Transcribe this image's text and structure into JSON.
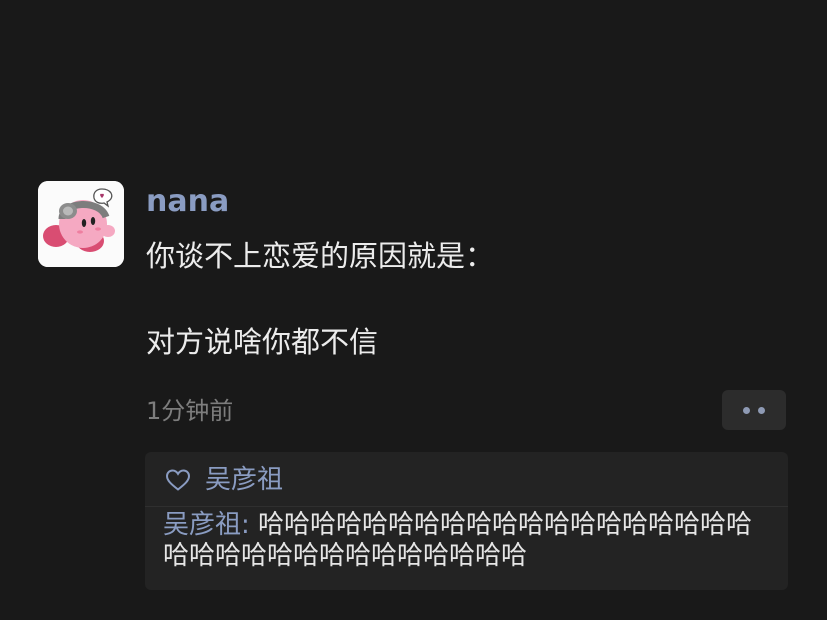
{
  "post": {
    "username": "nana",
    "content_lines": [
      "你谈不上恋爱的原因就是：",
      "对方说啥你都不信"
    ],
    "timestamp": "1分钟前"
  },
  "likes": {
    "icon": "heart-outline-icon",
    "names": "吴彦祖"
  },
  "comment": {
    "author": "吴彦祖",
    "separator": ": ",
    "text": "哈哈哈哈哈哈哈哈哈哈哈哈哈哈哈哈哈哈哈哈哈哈哈哈哈哈哈哈哈哈哈哈哈"
  },
  "colors": {
    "background": "#191919",
    "name_link": "#8a9cc2",
    "panel": "#232323"
  }
}
